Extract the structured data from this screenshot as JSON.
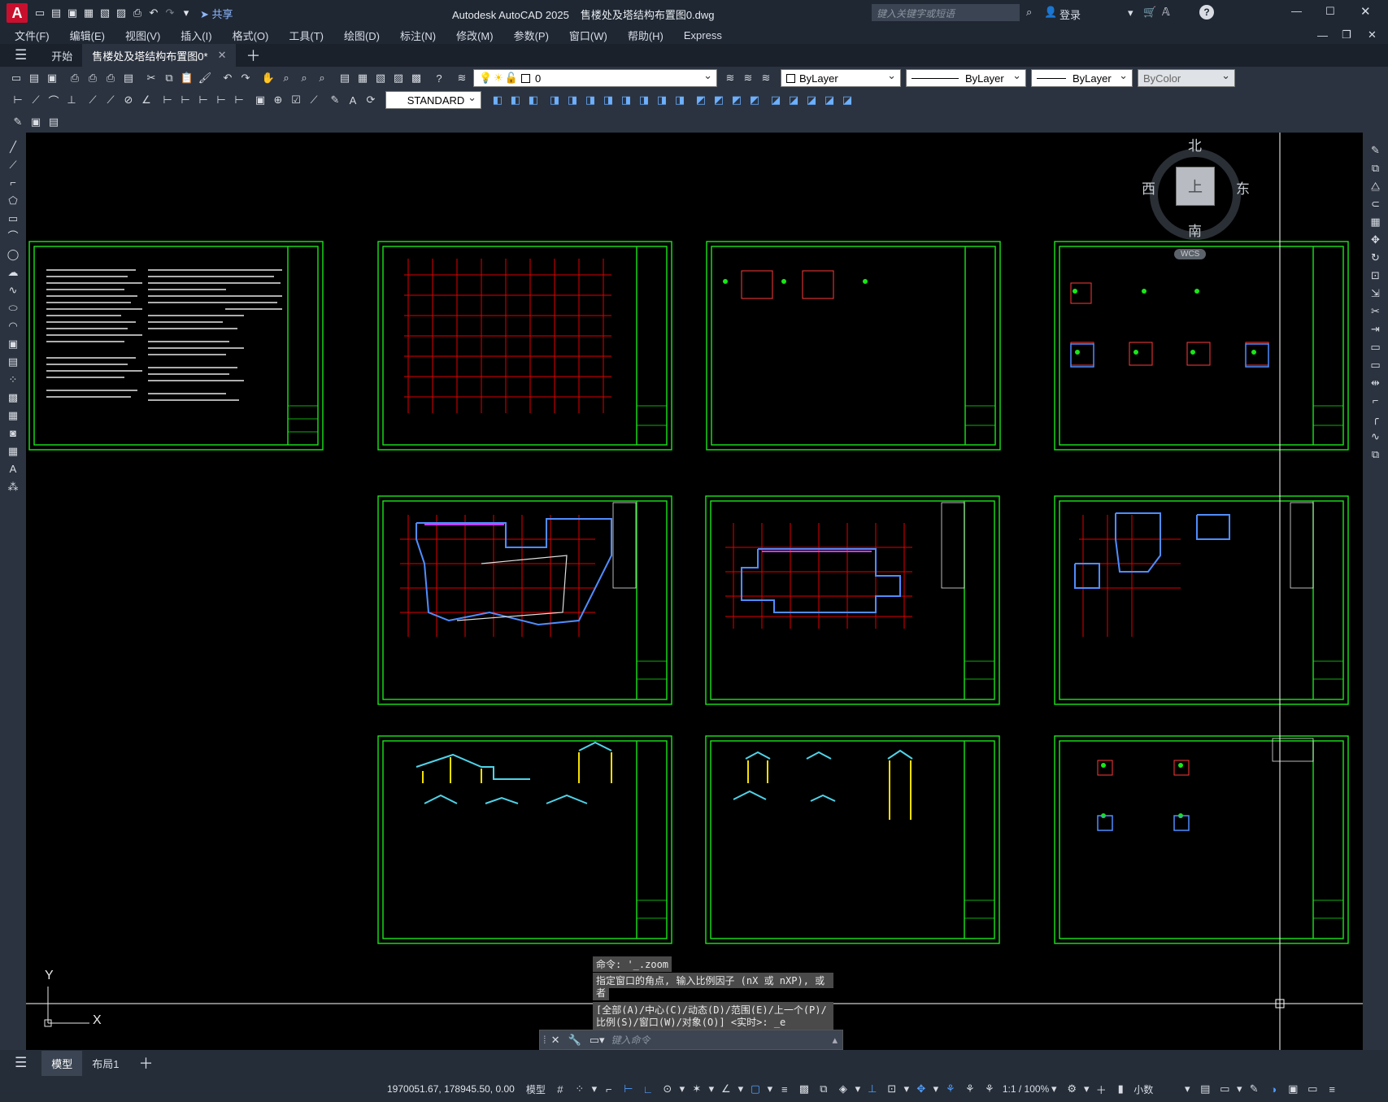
{
  "app": {
    "logo": "A",
    "title": "Autodesk AutoCAD 2025",
    "document": "售楼处及塔结构布置图0.dwg",
    "share": "共享",
    "search_placeholder": "键入关键字或短语",
    "login": "登录"
  },
  "menu": [
    "文件(F)",
    "编辑(E)",
    "视图(V)",
    "插入(I)",
    "格式(O)",
    "工具(T)",
    "绘图(D)",
    "标注(N)",
    "修改(M)",
    "参数(P)",
    "窗口(W)",
    "帮助(H)",
    "Express"
  ],
  "tabs": {
    "start": "开始",
    "active": "售楼处及塔结构布置图0*"
  },
  "props": {
    "layer": "0",
    "color": "ByLayer",
    "linetype": "ByLayer",
    "lineweight": "ByLayer",
    "plotstyle": "ByColor",
    "textstyle": "STANDARD"
  },
  "viewcube": {
    "north": "北",
    "south": "南",
    "east": "东",
    "west": "西",
    "face": "上",
    "wcs": "WCS"
  },
  "ucs": {
    "x": "X",
    "y": "Y"
  },
  "command": {
    "history": [
      "命令: '_.zoom",
      "指定窗口的角点, 输入比例因子 (nX 或 nXP), 或",
      "者",
      "[全部(A)/中心(C)/动态(D)/范围(E)/上一个(P)/",
      "比例(S)/窗口(W)/对象(O)] <实时>: _e"
    ],
    "placeholder": "键入命令"
  },
  "layouts": {
    "model": "模型",
    "layout1": "布局1"
  },
  "status": {
    "coords": "1970051.67, 178945.50, 0.00",
    "model": "模型",
    "scale": "1:1 / 100%",
    "units": "小数"
  },
  "colors": {
    "frame": "#19e619",
    "grid": "#e00000",
    "canvas": "#000000",
    "ui": "#2b3340"
  }
}
